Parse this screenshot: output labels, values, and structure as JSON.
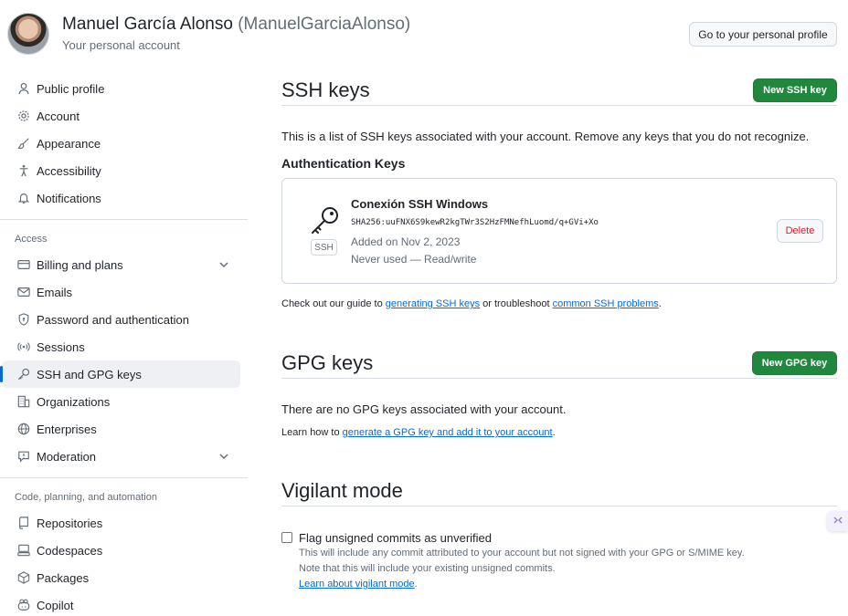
{
  "header": {
    "display_name": "Manuel García Alonso",
    "login": "(ManuelGarciaAlonso)",
    "subtitle": "Your personal account",
    "profile_button": "Go to your personal profile"
  },
  "sidebar": {
    "top_items": [
      {
        "label": "Public profile",
        "icon": "person-icon"
      },
      {
        "label": "Account",
        "icon": "gear-icon"
      },
      {
        "label": "Appearance",
        "icon": "paintbrush-icon"
      },
      {
        "label": "Accessibility",
        "icon": "accessibility-icon"
      },
      {
        "label": "Notifications",
        "icon": "bell-icon"
      }
    ],
    "access_heading": "Access",
    "access_items": [
      {
        "label": "Billing and plans",
        "icon": "credit-card-icon"
      },
      {
        "label": "Emails",
        "icon": "mail-icon"
      },
      {
        "label": "Password and authentication",
        "icon": "shield-lock-icon"
      },
      {
        "label": "Sessions",
        "icon": "broadcast-icon"
      },
      {
        "label": "SSH and GPG keys",
        "icon": "key-icon"
      },
      {
        "label": "Organizations",
        "icon": "organization-icon"
      },
      {
        "label": "Enterprises",
        "icon": "globe-icon"
      },
      {
        "label": "Moderation",
        "icon": "report-icon"
      }
    ],
    "code_heading": "Code, planning, and automation",
    "code_items": [
      {
        "label": "Repositories",
        "icon": "repo-icon"
      },
      {
        "label": "Codespaces",
        "icon": "codespaces-icon"
      },
      {
        "label": "Packages",
        "icon": "package-icon"
      },
      {
        "label": "Copilot",
        "icon": "copilot-icon"
      }
    ]
  },
  "ssh": {
    "title": "SSH keys",
    "new_button": "New SSH key",
    "description": "This is a list of SSH keys associated with your account. Remove any keys that you do not recognize.",
    "auth_heading": "Authentication Keys",
    "key": {
      "title": "Conexión SSH Windows",
      "fingerprint": "SHA256:uuFNX6S9kewR2kgTWr3S2HzFMNefhLuomd/q+GVi+Xo",
      "added": "Added on Nov 2, 2023",
      "usage": "Never used — Read/write",
      "badge": "SSH",
      "delete_label": "Delete"
    },
    "guide_prefix": "Check out our guide to ",
    "guide_link": "generating SSH keys",
    "guide_mid": " or troubleshoot ",
    "guide_link2": "common SSH problems",
    "guide_suffix": "."
  },
  "gpg": {
    "title": "GPG keys",
    "new_button": "New GPG key",
    "empty": "There are no GPG keys associated with your account.",
    "learn_prefix": "Learn how to ",
    "learn_link": "generate a GPG key and add it to your account",
    "learn_suffix": "."
  },
  "vigilant": {
    "title": "Vigilant mode",
    "checkbox_label": "Flag unsigned commits as unverified",
    "line1": "This will include any commit attributed to your account but not signed with your GPG or S/MIME key.",
    "line2": "Note that this will include your existing unsigned commits.",
    "link": "Learn about vigilant mode",
    "link_suffix": "."
  },
  "colors": {
    "primary_green": "#1f883d",
    "link_blue": "#0969da",
    "danger_red": "#cf222e",
    "active_indicator": "#0969da"
  }
}
